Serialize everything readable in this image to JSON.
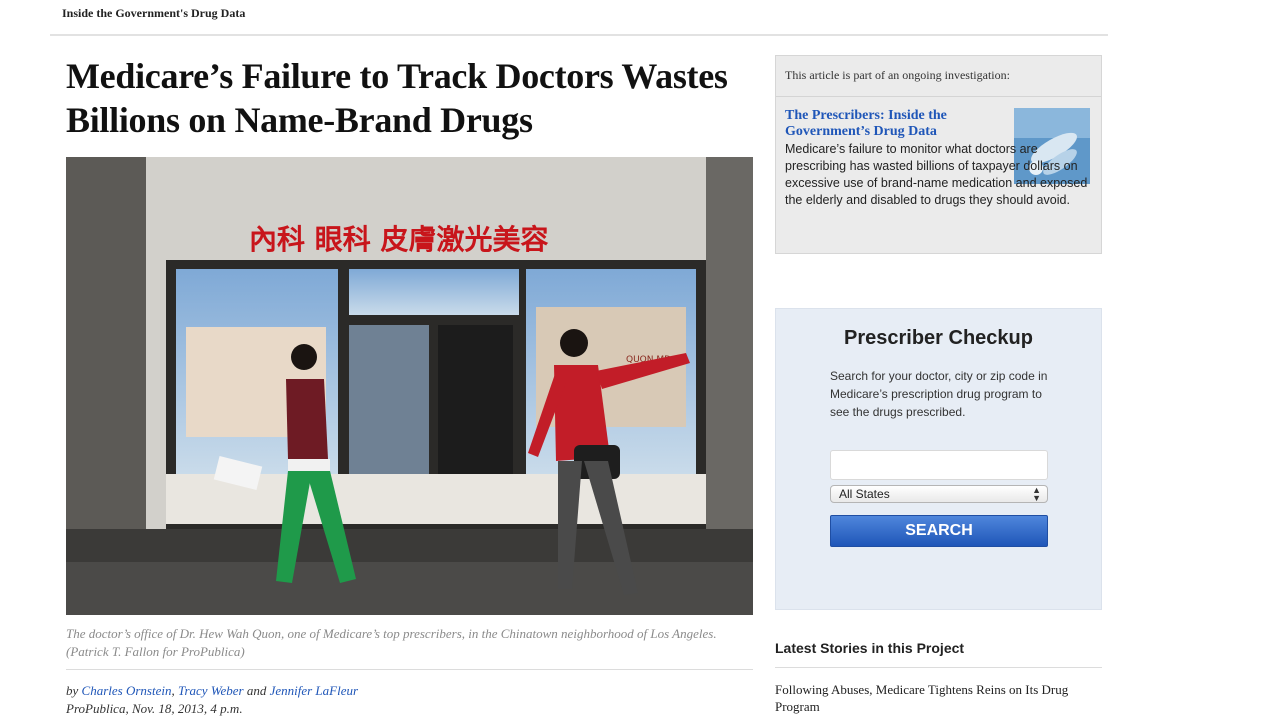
{
  "header": {
    "kicker": "Inside the Government's Drug Data"
  },
  "article": {
    "headline": "Medicare’s Failure to Track Doctors Wastes Billions on Name-Brand Drugs",
    "photo": {
      "sign_text": "內科 眼科 皮膚激光美容",
      "window_name": "QUON MD"
    },
    "caption": "The doctor’s office of Dr. Hew Wah Quon, one of Medicare’s top prescribers, in the Chinatown neighborhood of Los Angeles. (Patrick T. Fallon for ProPublica)",
    "byline": {
      "prefix": "by",
      "author1": "Charles Ornstein",
      "sep1": ",",
      "author2": "Tracy Weber",
      "and": "and",
      "author3": "Jennifer LaFleur",
      "dateline": "ProPublica, Nov. 18, 2013, 4 p.m."
    }
  },
  "sidebar": {
    "series": {
      "intro": "This article is part of an ongoing investigation:",
      "link": "The Prescribers: Inside the Government’s Drug Data",
      "description": "Medicare’s failure to monitor what doctors are prescribing has wasted billions of taxpayer dollars on excessive use of brand-name medication and exposed the elderly and disabled to drugs they should avoid."
    },
    "checkup": {
      "title": "Prescriber Checkup",
      "description": "Search for your doctor, city or zip code in Medicare’s prescription drug program to see the drugs prescribed.",
      "search_value": "",
      "state_selected": "All States",
      "search_label": "SEARCH"
    },
    "latest": {
      "title": "Latest Stories in this Project",
      "items": [
        "Following Abuses, Medicare Tightens Reins on Its Drug Program"
      ]
    }
  },
  "colors": {
    "link": "#1f56b8",
    "sign_red": "#c8151b",
    "button_blue": "#2a63c4",
    "checkup_bg": "#e7edf5"
  },
  "icons": {
    "select_arrows": "updown-arrows-icon"
  }
}
